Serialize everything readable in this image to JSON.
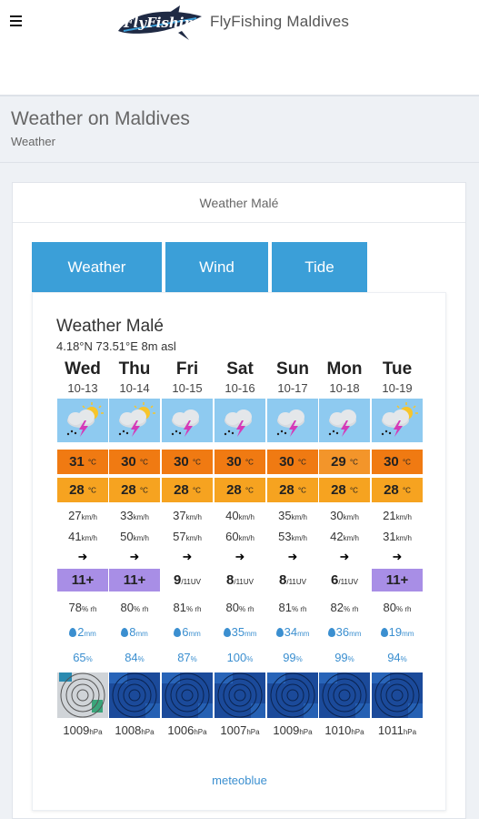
{
  "header": {
    "site_title": "FlyFishing Maldives",
    "logo_text": "FlyFishing"
  },
  "page": {
    "heading": "Weather on Maldives",
    "breadcrumb": "Weather"
  },
  "card": {
    "title": "Weather Malé"
  },
  "tabs": [
    {
      "label": "Weather"
    },
    {
      "label": "Wind"
    },
    {
      "label": "Tide"
    }
  ],
  "widget": {
    "title": "Weather Malé",
    "coords": "4.18°N 73.51°E 8m asl",
    "units": {
      "temp": "°C",
      "wind": "km/h",
      "humidity": "% rh",
      "precip": "mm",
      "prob": "%",
      "pressure": "hPa",
      "uv": "/11UV"
    },
    "wind_arrow": "➜",
    "days": [
      {
        "day": "Wed",
        "date": "10-13",
        "weather": "sun-cloud-thunder",
        "tmax": "31",
        "tmin": "28",
        "wind_mean": "27",
        "wind_gust": "41",
        "uv": "11+",
        "uv_high": true,
        "humidity": "78",
        "precip": "2",
        "prob": "65",
        "pressure": "1009",
        "radar": "light"
      },
      {
        "day": "Thu",
        "date": "10-14",
        "weather": "sun-cloud-thunder",
        "tmax": "30",
        "tmin": "28",
        "wind_mean": "33",
        "wind_gust": "50",
        "uv": "11+",
        "uv_high": true,
        "humidity": "80",
        "precip": "8",
        "prob": "84",
        "pressure": "1008",
        "radar": "dark"
      },
      {
        "day": "Fri",
        "date": "10-15",
        "weather": "cloud-thunder",
        "tmax": "30",
        "tmin": "28",
        "wind_mean": "37",
        "wind_gust": "57",
        "uv": "9",
        "uv_high": false,
        "humidity": "81",
        "precip": "6",
        "prob": "87",
        "pressure": "1006",
        "radar": "dark"
      },
      {
        "day": "Sat",
        "date": "10-16",
        "weather": "cloud-thunder",
        "tmax": "30",
        "tmin": "28",
        "wind_mean": "40",
        "wind_gust": "60",
        "uv": "8",
        "uv_high": false,
        "humidity": "80",
        "precip": "35",
        "prob": "100",
        "pressure": "1007",
        "radar": "dark"
      },
      {
        "day": "Sun",
        "date": "10-17",
        "weather": "cloud-thunder",
        "tmax": "30",
        "tmin": "28",
        "wind_mean": "35",
        "wind_gust": "53",
        "uv": "8",
        "uv_high": false,
        "humidity": "81",
        "precip": "34",
        "prob": "99",
        "pressure": "1009",
        "radar": "dark"
      },
      {
        "day": "Mon",
        "date": "10-18",
        "weather": "cloud-thunder",
        "tmax": "29",
        "tmin": "28",
        "wind_mean": "30",
        "wind_gust": "42",
        "uv": "6",
        "uv_high": false,
        "humidity": "82",
        "precip": "36",
        "prob": "99",
        "pressure": "1010",
        "radar": "dark"
      },
      {
        "day": "Tue",
        "date": "10-19",
        "weather": "sun-cloud-thunder",
        "tmax": "30",
        "tmin": "28",
        "wind_mean": "21",
        "wind_gust": "31",
        "uv": "11+",
        "uv_high": true,
        "humidity": "80",
        "precip": "19",
        "prob": "94",
        "pressure": "1011",
        "radar": "dark"
      }
    ],
    "colors": {
      "tmax": "#f07a12",
      "tmax_29": "#f3952a",
      "tmin": "#f6a320",
      "uv_high": "#a88ee6",
      "tab": "#3b9fd8",
      "precip": "#3b8fd0"
    }
  },
  "footer": {
    "credit": "meteoblue"
  }
}
